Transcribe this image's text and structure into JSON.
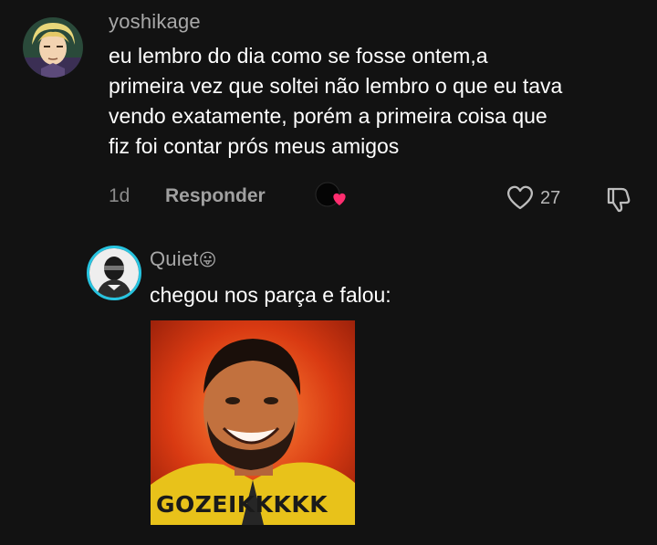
{
  "comment": {
    "username": "yoshikage",
    "text": "eu lembro do dia como se fosse ontem,a\nprimeira vez que soltei não lembro o que eu tava\nvendo exatamente, porém a primeira coisa que\nfiz foi contar prós meus amigos",
    "age": "1d",
    "reply_label": "Responder",
    "like_count": "27"
  },
  "reply": {
    "username": "Quiet",
    "username_emoji": "😛",
    "text": "chegou nos parça e falou:",
    "meme_caption": "GOZEIKKKKK"
  },
  "colors": {
    "background": "#121212",
    "username": "#a8a8a8",
    "meta": "#8a8a8a",
    "accent_pink": "#ff2d6f",
    "reply_avatar_ring": "#27c4e0"
  },
  "icons": {
    "like": "heart-outline-icon",
    "dislike": "thumbs-down-icon",
    "creator_like": "creator-liked-heart-icon"
  }
}
